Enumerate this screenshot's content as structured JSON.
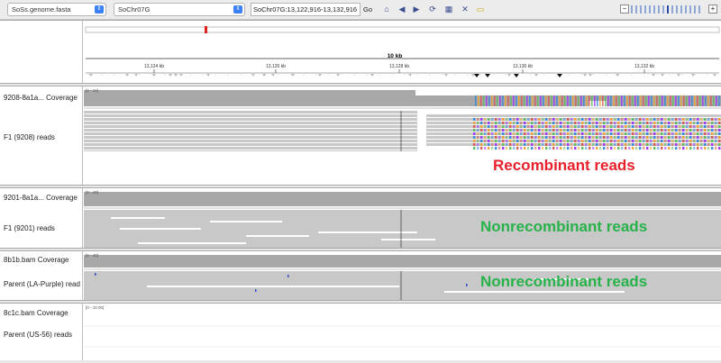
{
  "toolbar": {
    "genome": "SoSs.genome.fasta",
    "chromosome": "SoChr07G",
    "locus": "SoChr07G:13,122,916-13,132,916",
    "go_label": "Go",
    "icons": [
      "home-icon",
      "back-icon",
      "refresh-icon",
      "ruler-icon",
      "close-icon",
      "popup-text-icon"
    ]
  },
  "ruler": {
    "span_label": "10 kb",
    "ticks": [
      "13,124 kb",
      "13,126 kb",
      "13,128 kb",
      "13,130 kb",
      "13,132 kb"
    ]
  },
  "tracks": [
    {
      "coverage_label": "9208-8a1a... Coverage",
      "range": "[0 - 16]",
      "reads_label": "F1 (9208) reads"
    },
    {
      "coverage_label": "9201-8a1a... Coverage",
      "range": "[0 - 48]",
      "reads_label": "F1 (9201) reads"
    },
    {
      "coverage_label": "8b1b.bam Coverage",
      "range": "[0 - 40]",
      "reads_label": "Parent (LA-Purple) read"
    },
    {
      "coverage_label": "8c1c.bam Coverage",
      "range": "[0 - 10.00]",
      "reads_label": "Parent (US-56) reads"
    }
  ],
  "annotations": {
    "recombinant": "Recombinant reads",
    "nonrecombinant_1": "Nonrecombinant reads",
    "nonrecombinant_2": "Nonrecombinant reads"
  },
  "colors": {
    "recombinant_text": "#e8202a",
    "nonrecombinant_text": "#27b34a",
    "coverage": "#a8a8a8",
    "read": "#c8c8c8",
    "highlight": "#e02020"
  }
}
